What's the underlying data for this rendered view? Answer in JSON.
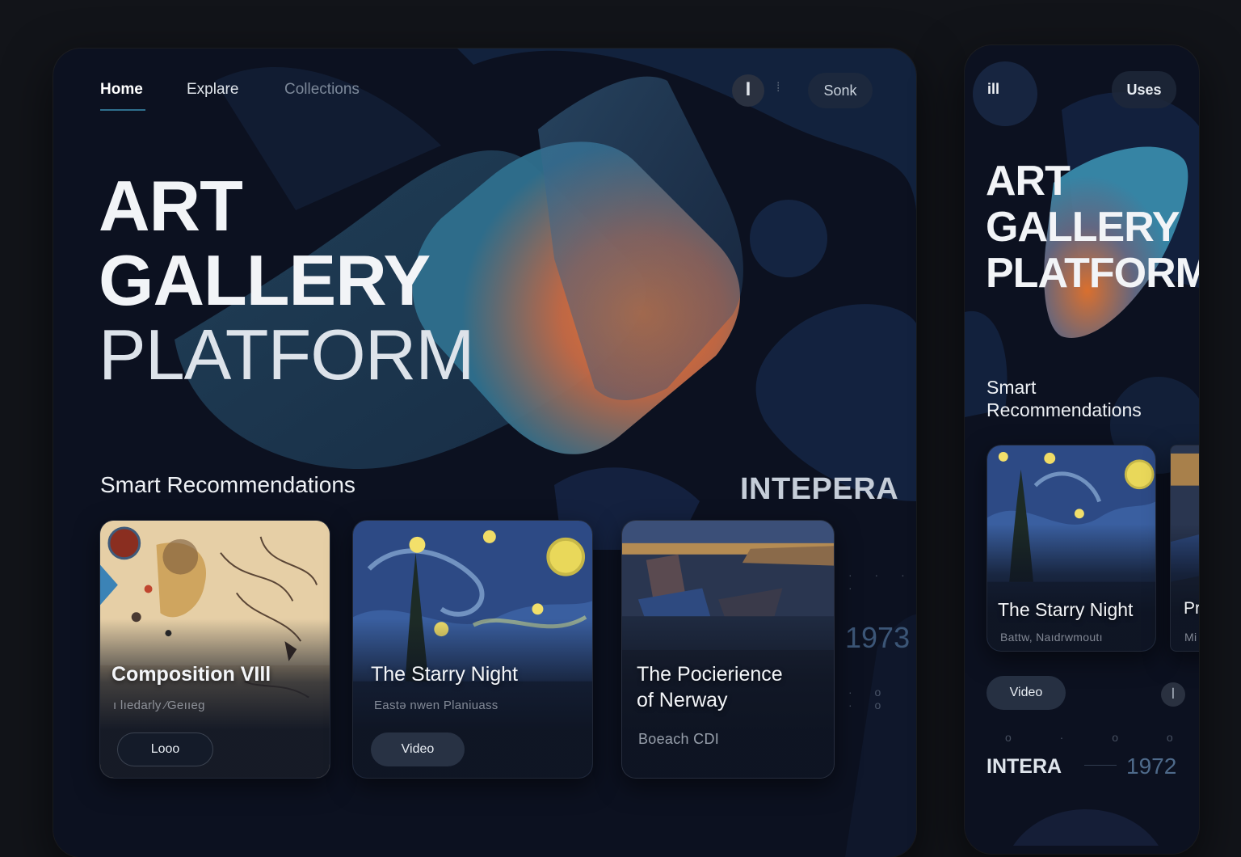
{
  "colors": {
    "page_bg": "#121419",
    "panel_bg": "#0c1120",
    "accent_orange": "#f07a30",
    "accent_teal": "#3a8fb0",
    "year_muted": "#4e6a8a"
  },
  "main": {
    "nav": {
      "home": "Home",
      "explore": "Explare",
      "collections": "Collections",
      "icon": "sync-icon",
      "separator": "⁞",
      "user": "Sonk"
    },
    "hero": {
      "line1": "ART",
      "line2": "GALLERY",
      "line3": "PLATFORM"
    },
    "section_title": "Smart Recommendations",
    "brand_mark": "INTEPERA",
    "year": "1973",
    "cards": [
      {
        "title": "Composition VIll",
        "subtitle": "ı lıedarly ⁄Geııeg",
        "button": "Looo"
      },
      {
        "title": "The Starry Night",
        "subtitle": "Eastə nwen Planiuass",
        "button": "Video"
      },
      {
        "title_line1": "The Pocierience",
        "title_line2": "of Nerway",
        "subtitle": "Boeach CDI"
      }
    ]
  },
  "side": {
    "menu_icon": "ill",
    "user_button": "Uses",
    "hero": {
      "line1": "ART",
      "line2": "GALLERY",
      "line3": "PLATFORM"
    },
    "section_title_line1": "Smart",
    "section_title_line2": "Recommendations",
    "card": {
      "title": "The Starry Night",
      "subtitle": "Battw, Naıdrwmoutı"
    },
    "peek_card": {
      "title": "Pr",
      "subtitle": "Mi"
    },
    "video_button": "Video",
    "icon": "sync-icon",
    "brand_mark": "INTERA",
    "year": "1972"
  }
}
